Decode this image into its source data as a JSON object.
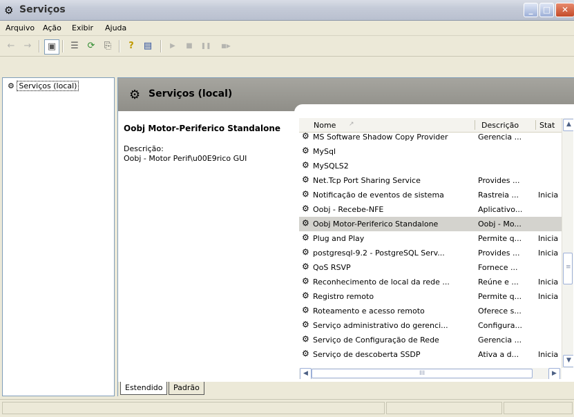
{
  "window": {
    "title": "Serviços",
    "minimize": "_",
    "maximize": "□",
    "close": "✕"
  },
  "menu": [
    "Arquivo",
    "Ação",
    "Exibir",
    "Ajuda"
  ],
  "toolbar": {
    "back_icon": "←",
    "forward_icon": "→",
    "up_icon": "▣",
    "properties_icon": "☰",
    "refresh_icon": "⟳",
    "export_icon": "⎘",
    "help_icon": "?",
    "console_icon": "▤",
    "play_icon": "▶",
    "stop_icon": "■",
    "pause_icon": "❚❚",
    "restart_icon": "■▶"
  },
  "tree": {
    "root_label": "Serviços (local)",
    "icon": "⚙"
  },
  "header": {
    "title": "Serviços (local)",
    "icon": "⚙"
  },
  "details": {
    "service_name": "Oobj Motor-Periferico Standalone",
    "description_label": "Descrição:",
    "description_text": "Oobj - Motor Perif\\u00E9rico GUI"
  },
  "list": {
    "columns": [
      "Nome",
      "Descrição",
      "Stat"
    ],
    "rows": [
      {
        "name": "MS Software Shadow Copy Provider",
        "desc": "Gerencia ...",
        "status": ""
      },
      {
        "name": "MySql",
        "desc": "",
        "status": ""
      },
      {
        "name": "MySQLS2",
        "desc": "",
        "status": ""
      },
      {
        "name": "Net.Tcp Port Sharing Service",
        "desc": "Provides ...",
        "status": ""
      },
      {
        "name": "Notificação de eventos de sistema",
        "desc": "Rastreia ...",
        "status": "Inicia"
      },
      {
        "name": "Oobj - Recebe-NFE",
        "desc": "Aplicativo...",
        "status": ""
      },
      {
        "name": "Oobj Motor-Periferico Standalone",
        "desc": "Oobj - Mo...",
        "status": ""
      },
      {
        "name": "Plug and Play",
        "desc": "Permite q...",
        "status": "Inicia"
      },
      {
        "name": "postgresql-9.2 - PostgreSQL Serv...",
        "desc": "Provides ...",
        "status": "Inicia"
      },
      {
        "name": "QoS RSVP",
        "desc": "Fornece ...",
        "status": ""
      },
      {
        "name": "Reconhecimento de local da rede ...",
        "desc": "Reúne e ...",
        "status": "Inicia"
      },
      {
        "name": "Registro remoto",
        "desc": "Permite q...",
        "status": "Inicia"
      },
      {
        "name": "Roteamento e acesso remoto",
        "desc": "Oferece s...",
        "status": ""
      },
      {
        "name": "Serviço administrativo do gerenci...",
        "desc": "Configura...",
        "status": ""
      },
      {
        "name": "Serviço de Configuração de Rede",
        "desc": "Gerencia ...",
        "status": ""
      },
      {
        "name": "Serviço de descoberta SSDP",
        "desc": "Ativa a d...",
        "status": "Inicia"
      }
    ],
    "selected_index": 6,
    "row_icon": "⚙"
  },
  "tabs": [
    "Estendido",
    "Padrão"
  ],
  "scroll": {
    "up": "▲",
    "down": "▼",
    "left": "◀",
    "right": "▶",
    "grip": "≡",
    "hgrip": "III"
  }
}
